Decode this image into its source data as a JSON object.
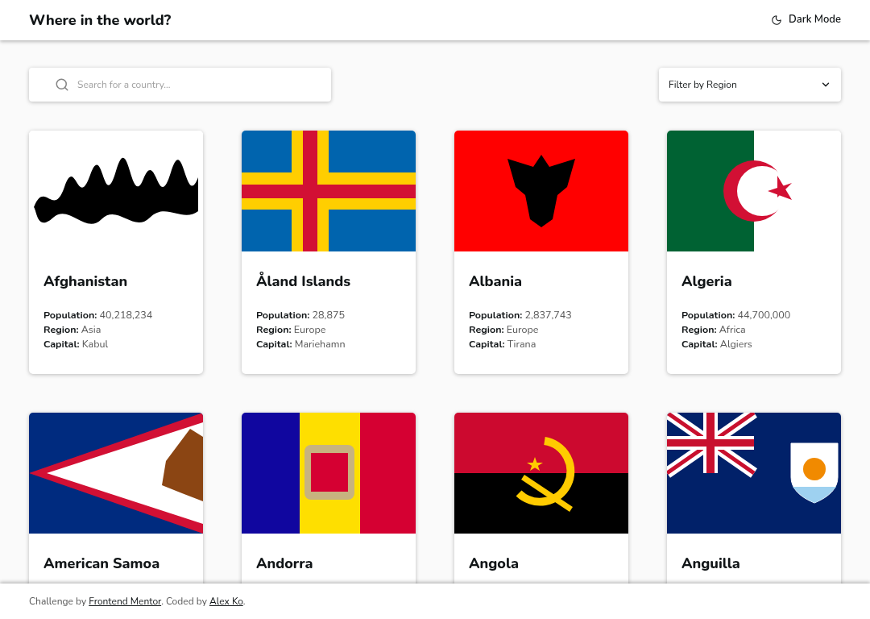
{
  "header": {
    "title": "Where in the world?",
    "theme_toggle": "Dark Mode"
  },
  "search": {
    "placeholder": "Search for a country..."
  },
  "filter": {
    "label": "Filter by Region"
  },
  "countries": [
    {
      "kind": "afghanistan",
      "name": "Afghanistan",
      "stats": [
        {
          "label": "Population:",
          "value": "40,218,234"
        },
        {
          "label": "Region:",
          "value": "Asia"
        },
        {
          "label": "Capital:",
          "value": "Kabul"
        }
      ]
    },
    {
      "kind": "aland",
      "name": "Åland Islands",
      "stats": [
        {
          "label": "Population:",
          "value": "28,875"
        },
        {
          "label": "Region:",
          "value": "Europe"
        },
        {
          "label": "Capital:",
          "value": "Mariehamn"
        }
      ]
    },
    {
      "kind": "albania",
      "name": "Albania",
      "stats": [
        {
          "label": "Population:",
          "value": "2,837,743"
        },
        {
          "label": "Region:",
          "value": "Europe"
        },
        {
          "label": "Capital:",
          "value": "Tirana"
        }
      ]
    },
    {
      "kind": "algeria",
      "name": "Algeria",
      "stats": [
        {
          "label": "Population:",
          "value": "44,700,000"
        },
        {
          "label": "Region:",
          "value": "Africa"
        },
        {
          "label": "Capital:",
          "value": "Algiers"
        }
      ]
    },
    {
      "kind": "samoa",
      "name": "American Samoa"
    },
    {
      "kind": "andorra",
      "name": "Andorra"
    },
    {
      "kind": "angola",
      "name": "Angola"
    },
    {
      "kind": "anguilla",
      "name": "Anguilla"
    }
  ],
  "footer": {
    "before": "Challenge by",
    "link_1": "Frontend Mentor",
    "middle": ". Coded by",
    "link_2": "Alex Ko",
    "after": "."
  }
}
